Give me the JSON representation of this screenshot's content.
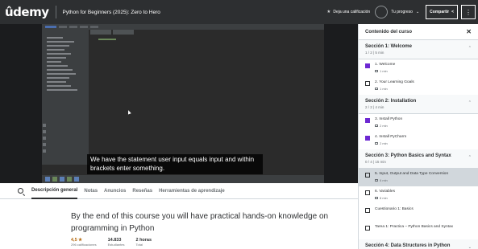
{
  "header": {
    "logo": "ûdemy",
    "course_title": "Python for Beginners (2025): Zero to Hero",
    "rating_label": "Deja una calificación",
    "progress_label": "Tu progreso",
    "progress_chevron": "⌄",
    "share_label": "Compartir",
    "more_label": "⋮"
  },
  "video": {
    "caption": "We have the statement user input equals input and within brackets enter something."
  },
  "tabs": [
    {
      "label": "Descripción general",
      "active": true
    },
    {
      "label": "Notas",
      "active": false
    },
    {
      "label": "Anuncios",
      "active": false
    },
    {
      "label": "Reseñas",
      "active": false
    },
    {
      "label": "Herramientas de aprendizaje",
      "active": false
    }
  ],
  "overview": {
    "text": "By the end of this course you will have practical hands-on knowledge on programming in Python",
    "stats": [
      {
        "value": "4,5 ★",
        "label": "296 calificaciones"
      },
      {
        "value": "14.833",
        "label": "Estudiantes"
      },
      {
        "value": "2 horas",
        "label": "Total"
      }
    ]
  },
  "sidebar": {
    "title": "Contenido del curso",
    "close": "✕",
    "sections": [
      {
        "title": "Sección 1: Welcome",
        "meta": "1 / 2 | 5 min",
        "expanded": true,
        "lectures": [
          {
            "title": "1. Welcome",
            "duration": "1 min",
            "checked": true,
            "active": false
          },
          {
            "title": "2. Your Learning Goals",
            "duration": "1 min",
            "checked": false,
            "active": false
          }
        ]
      },
      {
        "title": "Sección 2: Installation",
        "meta": "2 / 2 | 4 min",
        "expanded": true,
        "lectures": [
          {
            "title": "3. Install Python",
            "duration": "2 min",
            "checked": true,
            "active": false
          },
          {
            "title": "4. Install PyCharm",
            "duration": "2 min",
            "checked": true,
            "active": false
          }
        ]
      },
      {
        "title": "Sección 3: Python Basics and Syntax",
        "meta": "0 / 4 | 15 min",
        "expanded": true,
        "lectures": [
          {
            "title": "5. Input, Output and Data Type Conversion",
            "duration": "6 min",
            "checked": false,
            "active": true
          },
          {
            "title": "6. Variables",
            "duration": "8 min",
            "checked": false,
            "active": false
          },
          {
            "title": "Cuestionario 1: Basics",
            "duration": "",
            "checked": false,
            "active": false
          },
          {
            "title": "Tarea 1: Practica – Python Basics and Syntax",
            "duration": "",
            "checked": false,
            "active": false
          }
        ]
      },
      {
        "title": "Sección 4: Data Structures in Python",
        "meta": "",
        "expanded": false,
        "lectures": []
      }
    ]
  },
  "colors": {
    "header_bg": "#2d2f31",
    "accent_purple": "#6d28d2",
    "rating_orange": "#b4690e",
    "active_lecture_bg": "#d1d7dc"
  }
}
